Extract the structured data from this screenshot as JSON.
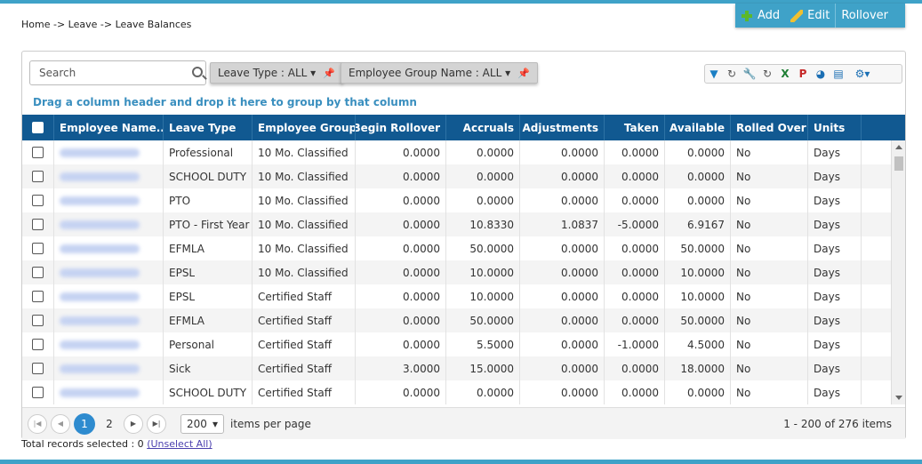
{
  "breadcrumb": "Home -> Leave -> Leave Balances",
  "actions": {
    "add": "Add",
    "edit": "Edit",
    "rollover": "Rollover"
  },
  "search": {
    "placeholder": "Search"
  },
  "filters": {
    "leave_type": "Leave Type : ALL ▾",
    "employee_group": "Employee Group Name : ALL ▾"
  },
  "group_hint": "Drag a column header and drop it here to group by that column",
  "columns": [
    "Employee Name...",
    "Leave Type",
    "Employee Group",
    "Begin Rollover",
    "Accruals",
    "Adjustments",
    "Taken",
    "Available",
    "Rolled Over",
    "Units"
  ],
  "rows": [
    [
      "Professional",
      "10 Mo. Classified",
      "0.0000",
      "0.0000",
      "0.0000",
      "0.0000",
      "0.0000",
      "No",
      "Days"
    ],
    [
      "SCHOOL DUTY",
      "10 Mo. Classified",
      "0.0000",
      "0.0000",
      "0.0000",
      "0.0000",
      "0.0000",
      "No",
      "Days"
    ],
    [
      "PTO",
      "10 Mo. Classified",
      "0.0000",
      "0.0000",
      "0.0000",
      "0.0000",
      "0.0000",
      "No",
      "Days"
    ],
    [
      "PTO - First Year",
      "10 Mo. Classified",
      "0.0000",
      "10.8330",
      "1.0837",
      "-5.0000",
      "6.9167",
      "No",
      "Days"
    ],
    [
      "EFMLA",
      "10 Mo. Classified",
      "0.0000",
      "50.0000",
      "0.0000",
      "0.0000",
      "50.0000",
      "No",
      "Days"
    ],
    [
      "EPSL",
      "10 Mo. Classified",
      "0.0000",
      "10.0000",
      "0.0000",
      "0.0000",
      "10.0000",
      "No",
      "Days"
    ],
    [
      "EPSL",
      "Certified Staff",
      "0.0000",
      "10.0000",
      "0.0000",
      "0.0000",
      "10.0000",
      "No",
      "Days"
    ],
    [
      "EFMLA",
      "Certified Staff",
      "0.0000",
      "50.0000",
      "0.0000",
      "0.0000",
      "50.0000",
      "No",
      "Days"
    ],
    [
      "Personal",
      "Certified Staff",
      "0.0000",
      "5.5000",
      "0.0000",
      "-1.0000",
      "4.5000",
      "No",
      "Days"
    ],
    [
      "Sick",
      "Certified Staff",
      "3.0000",
      "15.0000",
      "0.0000",
      "0.0000",
      "18.0000",
      "No",
      "Days"
    ],
    [
      "SCHOOL DUTY",
      "Certified Staff",
      "0.0000",
      "0.0000",
      "0.0000",
      "0.0000",
      "0.0000",
      "No",
      "Days"
    ]
  ],
  "pager": {
    "pages": [
      "1",
      "2"
    ],
    "per_page": "200",
    "per_page_label": "items per page",
    "info": "1 - 200 of 276 items"
  },
  "footer": {
    "text": "Total records selected : 0",
    "unselect": "(Unselect All)"
  },
  "colors": {
    "accent": "#3fa2c8",
    "header": "#115991",
    "active_page": "#2e8bcf"
  }
}
